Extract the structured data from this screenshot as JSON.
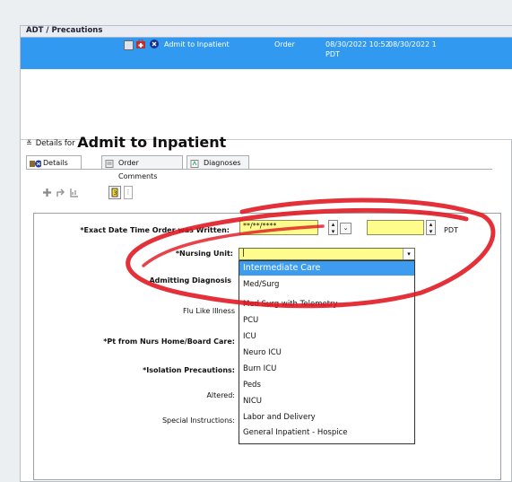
{
  "window": {
    "section_title": "ADT / Precautions"
  },
  "order_row": {
    "name": "Admit to Inpatient",
    "type": "Order",
    "datetime": "08/30/2022 10:52",
    "tz": "PDT",
    "datetime2": "08/30/2022 1"
  },
  "details": {
    "prefix": "Details for",
    "title": "Admit to Inpatient"
  },
  "tabs": [
    {
      "label": "Details"
    },
    {
      "label": "Order Comments"
    },
    {
      "label": "Diagnoses"
    }
  ],
  "form": {
    "date_label": "*Exact Date  Time Order was Written:",
    "date_value": "**/**/****",
    "tz_suffix": "PDT",
    "nursing_unit_label": "*Nursing Unit:",
    "nursing_unit_value": "|",
    "admitting_dx_label": "Admitting Diagnosis",
    "flu_label": "Flu Like Illness",
    "pt_from_label": "*Pt from Nurs Home/Board Care:",
    "isolation_label": "*Isolation Precautions:",
    "altered_label": "Altered:",
    "special_label": "Special Instructions:"
  },
  "dropdown": {
    "options": [
      "Intermediate Care",
      "Med/Surg",
      "Med Surg with Telemetry",
      "PCU",
      "ICU",
      "Neuro ICU",
      "Burn ICU",
      "Peds",
      "NICU",
      "Labor and Delivery",
      "General Inpatient - Hospice"
    ],
    "selected_index": 0
  },
  "colors": {
    "selected_row": "#3299f0",
    "required_field": "#fefc8a",
    "annotation": "#e0141e"
  }
}
